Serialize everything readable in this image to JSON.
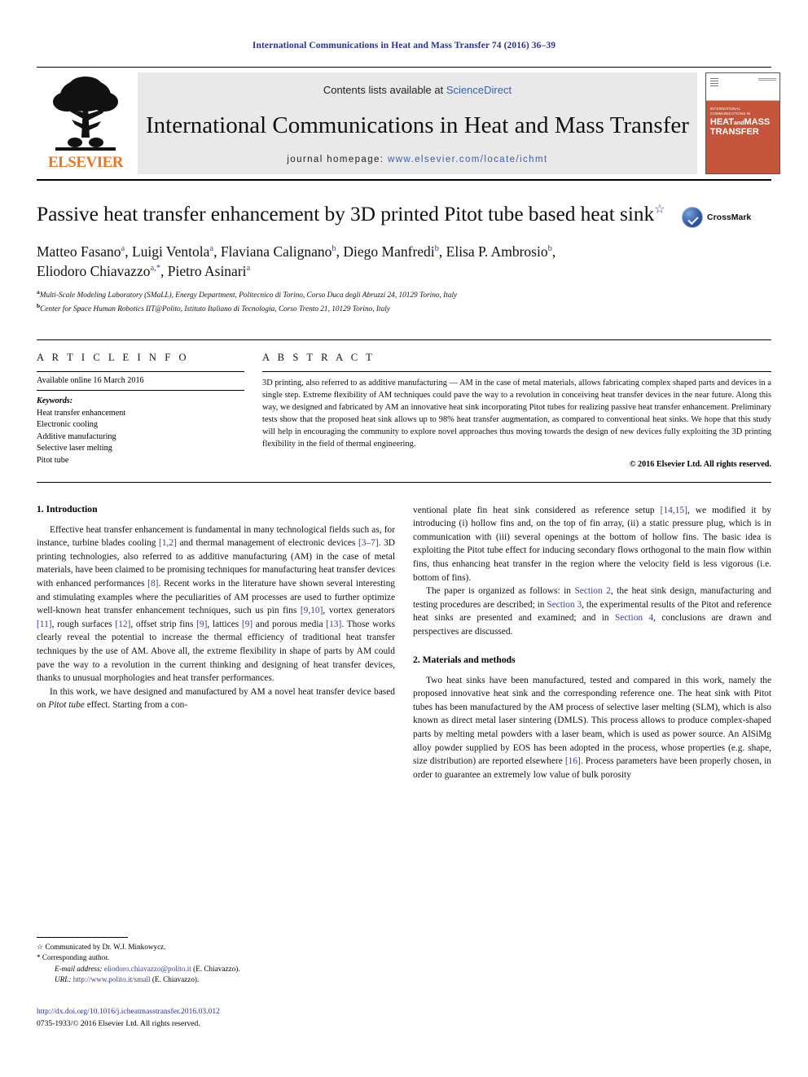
{
  "running_head": "International Communications in Heat and Mass Transfer 74 (2016) 36–39",
  "masthead": {
    "publisher_name": "ELSEVIER",
    "contents_prefix": "Contents lists available at ",
    "sciencedirect": "ScienceDirect",
    "journal_name": "International Communications in Heat and Mass Transfer",
    "homepage_label": "journal homepage:",
    "homepage_url": "www.elsevier.com/locate/ichmt",
    "cover": {
      "kicker": "INTERNATIONAL COMMUNICATIONS IN",
      "line1": "HEAT",
      "line_and": "and",
      "line2": "MASS",
      "line3": "TRANSFER"
    }
  },
  "article": {
    "title": "Passive heat transfer enhancement by 3D printed Pitot tube based heat sink",
    "title_mark": "☆",
    "crossmark_label": "CrossMark",
    "authors_line1": "Matteo Fasano",
    "authors_full": [
      {
        "name": "Matteo Fasano",
        "sup": "a",
        "sep": ", "
      },
      {
        "name": "Luigi Ventola",
        "sup": "a",
        "sep": ", "
      },
      {
        "name": "Flaviana Calignano",
        "sup": "b",
        "sep": ", "
      },
      {
        "name": "Diego Manfredi",
        "sup": "b",
        "sep": ", "
      },
      {
        "name": "Elisa P. Ambrosio",
        "sup": "b",
        "sep": ", "
      },
      {
        "name": "Eliodoro Chiavazzo",
        "sup": "a,*",
        "sep": ", "
      },
      {
        "name": "Pietro Asinari",
        "sup": "a",
        "sep": ""
      }
    ],
    "affiliation_a": "Multi-Scale Modeling Laboratory (SMaLL), Energy Department, Politecnico di Torino, Corso Duca degli Abruzzi 24, 10129 Torino, Italy",
    "affiliation_b": "Center for Space Human Robotics IIT@Polito, Istituto Italiano di Tecnologia, Corso Trento 21, 10129 Torino, Italy"
  },
  "article_info": {
    "heading": "A R T I C L E    I N F O",
    "history": "Available online 16 March 2016",
    "keywords_heading": "Keywords:",
    "keywords": [
      "Heat transfer enhancement",
      "Electronic cooling",
      "Additive manufacturing",
      "Selective laser melting",
      "Pitot tube"
    ]
  },
  "abstract": {
    "heading": "A B S T R A C T",
    "text": "3D printing, also referred to as additive manufacturing — AM in the case of metal materials, allows fabricating complex shaped parts and devices in a single step. Extreme flexibility of AM techniques could pave the way to a revolution in conceiving heat transfer devices in the near future. Along this way, we designed and fabricated by AM an innovative heat sink incorporating Pitot tubes for realizing passive heat transfer enhancement. Preliminary tests show that the proposed heat sink allows up to 98% heat transfer augmentation, as compared to conventional heat sinks. We hope that this study will help in encouraging the community to explore novel approaches thus moving towards the design of new devices fully exploiting the 3D printing flexibility in the field of thermal engineering.",
    "copyright": "© 2016 Elsevier Ltd. All rights reserved."
  },
  "sections": {
    "intro_heading": "1. Introduction",
    "intro_p1_a": "Effective heat transfer enhancement is fundamental in many technological fields such as, for instance, turbine blades cooling ",
    "ref_1_2": "[1,2]",
    "intro_p1_b": " and thermal management of electronic devices ",
    "ref_3_7": "[3–7]",
    "intro_p1_c": ". 3D printing technologies, also referred to as additive manufacturing (AM) in the case of metal materials, have been claimed to be promising techniques for manufacturing heat transfer devices with enhanced performances ",
    "ref_8": "[8]",
    "intro_p1_d": ". Recent works in the literature have shown several interesting and stimulating examples where the peculiarities of AM processes are used to further optimize well-known heat transfer enhancement techniques, such us pin fins ",
    "ref_9_10": "[9,10]",
    "intro_p1_e": ", vortex generators ",
    "ref_11": "[11]",
    "intro_p1_f": ", rough surfaces ",
    "ref_12": "[12]",
    "intro_p1_g": ", offset strip fins ",
    "ref_9a": "[9]",
    "intro_p1_h": ", lattices ",
    "ref_9b": "[9]",
    "intro_p1_i": " and porous media ",
    "ref_13": "[13]",
    "intro_p1_j": ". Those works clearly reveal the potential to increase the thermal efficiency of traditional heat transfer techniques by the use of AM. Above all, the extreme flexibility in shape of parts by AM could pave the way to a revolution in the current thinking and designing of heat transfer devices, thanks to unusual morphologies and heat transfer performances.",
    "intro_p2_a": "In this work, we have designed and manufactured by AM a novel heat transfer device based on ",
    "intro_p2_ital": "Pitot tube",
    "intro_p2_b": " effect. Starting from a con-",
    "right_p1_a": "ventional plate fin heat sink considered as reference setup ",
    "ref_14_15": "[14,15]",
    "right_p1_b": ", we modified it by introducing (i) hollow fins and, on the top of fin array, (ii) a static pressure plug, which is in communication with (iii) several openings at the bottom of hollow fins. The basic idea is exploiting the Pitot tube effect for inducing secondary flows orthogonal to the main flow within fins, thus enhancing heat transfer in the region where the velocity field is less vigorous (i.e. bottom of fins).",
    "right_p2_a": "The paper is organized as follows: in ",
    "link_section2": "Section 2",
    "right_p2_b": ", the heat sink design, manufacturing and testing procedures are described; in ",
    "link_section3": "Section 3",
    "right_p2_c": ", the experimental results of the Pitot and reference heat sinks are presented and examined; and in ",
    "link_section4": "Section 4",
    "right_p2_d": ", conclusions are drawn and perspectives are discussed.",
    "materials_heading": "2. Materials and methods",
    "right_p3_a": "Two heat sinks have been manufactured, tested and compared in this work, namely the proposed innovative heat sink and the corresponding reference one. The heat sink with Pitot tubes has been manufactured by the AM process of selective laser melting (SLM), which is also known as direct metal laser sintering (DMLS). This process allows to produce complex-shaped parts by melting metal powders with a laser beam, which is used as power source. An AlSiMg alloy powder supplied by EOS has been adopted in the process, whose properties (e.g. shape, size distribution) are reported elsewhere ",
    "ref_16": "[16]",
    "right_p3_b": ". Process parameters have been properly chosen, in order to guarantee an extremely low value of bulk porosity"
  },
  "footnotes": {
    "communicated_mark": "☆",
    "communicated": "Communicated by Dr. W.J. Minkowycz.",
    "corresponding_mark": "*",
    "corresponding": "Corresponding author.",
    "email_label": "E-mail address:",
    "email_value": "eliodoro.chiavazzo@polito.it",
    "email_owner": "(E. Chiavazzo).",
    "url_label": "URL:",
    "url_value": "http://www.polito.it/small",
    "url_owner": "(E. Chiavazzo)."
  },
  "footer": {
    "doi": "http://dx.doi.org/10.1016/j.icheatmasstransfer.2016.03.012",
    "issn_line": "0735-1933/© 2016 Elsevier Ltd. All rights reserved."
  },
  "colors": {
    "link_blue": "#3a3f8f",
    "header_blue": "#2e3192",
    "elsevier_orange": "#e87722",
    "cover_red": "#c5553a",
    "masthead_gray": "#e9e9e9"
  }
}
